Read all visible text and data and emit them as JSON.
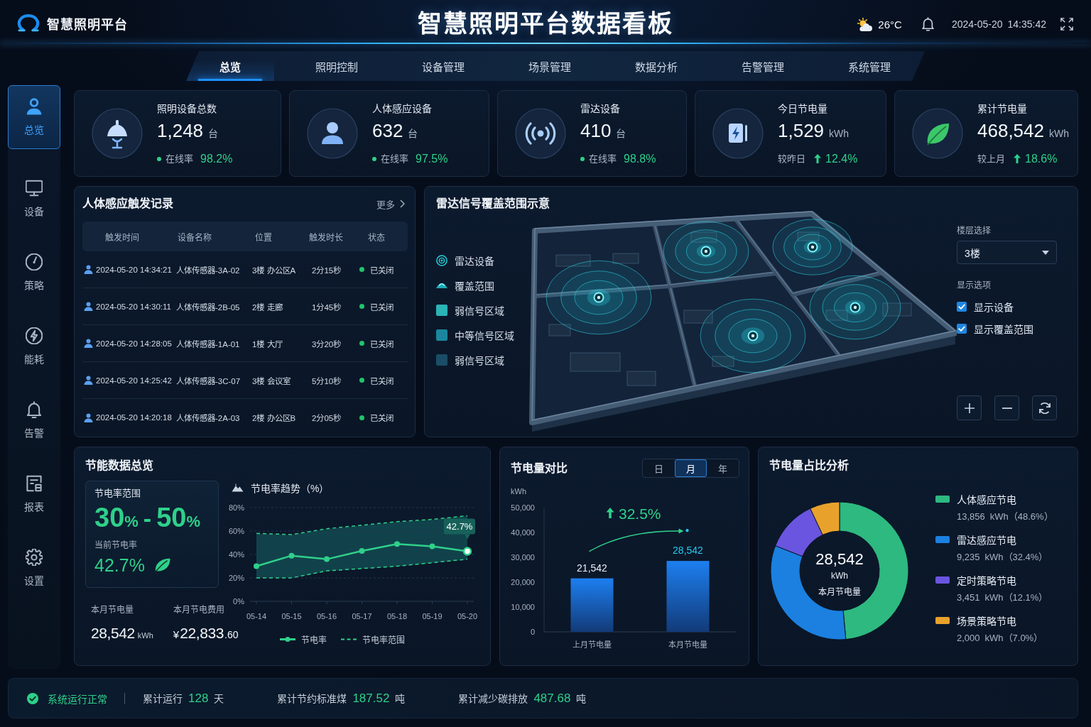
{
  "header": {
    "logo_text": "智慧照明平台",
    "title": "智慧照明平台数据看板",
    "temperature": "26°C",
    "date": "2024-05-20",
    "time": "14:35:42"
  },
  "nav_tabs": [
    {
      "label": "总览",
      "selected": true
    },
    {
      "label": "照明控制",
      "selected": false
    },
    {
      "label": "设备管理",
      "selected": false
    },
    {
      "label": "场景管理",
      "selected": false
    },
    {
      "label": "数据分析",
      "selected": false
    },
    {
      "label": "告警管理",
      "selected": false
    },
    {
      "label": "系统管理",
      "selected": false
    }
  ],
  "sidebar": {
    "items": [
      {
        "label": "总览",
        "selected": true
      },
      {
        "label": "设备",
        "selected": false
      },
      {
        "label": "策略",
        "selected": false
      },
      {
        "label": "能耗",
        "selected": false
      },
      {
        "label": "告警",
        "selected": false
      },
      {
        "label": "报表",
        "selected": false
      },
      {
        "label": "设置",
        "selected": false
      }
    ]
  },
  "kpi_cards": [
    {
      "kind": "online",
      "label": "照明设备总数",
      "value": "1,248",
      "unit": "台",
      "sub_label": "在线率",
      "sub_value": "98.2%"
    },
    {
      "kind": "online",
      "label": "人体感应设备",
      "value": "632",
      "unit": "台",
      "sub_label": "在线率",
      "sub_value": "97.5%"
    },
    {
      "kind": "online",
      "label": "雷达设备",
      "value": "410",
      "unit": "台",
      "sub_label": "在线率",
      "sub_value": "98.8%"
    },
    {
      "kind": "change",
      "label": "今日节电量",
      "value": "1,529",
      "unit": "kWh",
      "sub_label": "较昨日",
      "sub_value": "12.4%",
      "increase": true
    },
    {
      "kind": "change",
      "label": "累计节电量",
      "value": "468,542",
      "unit": "kWh",
      "sub_label": "较上月",
      "sub_value": "18.6%",
      "increase": true
    }
  ],
  "trigger_records": {
    "title": "人体感应触发记录",
    "more_link": "更多",
    "columns": [
      "触发时间",
      "设备名称",
      "位置",
      "触发时长",
      "状态"
    ],
    "rows": [
      {
        "cells": [
          "2024-05-20 14:34:21",
          "人体传感器-3A-02",
          "3楼 办公区A",
          "2分15秒",
          "已关闭"
        ]
      },
      {
        "cells": [
          "2024-05-20 14:30:11",
          "人体传感器-2B-05",
          "2楼 走廊",
          "1分45秒",
          "已关闭"
        ]
      },
      {
        "cells": [
          "2024-05-20 14:28:05",
          "人体传感器-1A-01",
          "1楼 大厅",
          "3分20秒",
          "已关闭"
        ]
      },
      {
        "cells": [
          "2024-05-20 14:25:42",
          "人体传感器-3C-07",
          "3楼 会议室",
          "5分10秒",
          "已关闭"
        ]
      },
      {
        "cells": [
          "2024-05-20 14:20:18",
          "人体传感器-2A-03",
          "2楼 办公区B",
          "2分05秒",
          "已关闭"
        ]
      }
    ]
  },
  "radar_panel": {
    "title": "雷达信号覆盖范围示意",
    "legend": [
      {
        "kind": "device",
        "label": "雷达设备"
      },
      {
        "kind": "coverage",
        "label": "覆盖范围"
      },
      {
        "kind": "swatch",
        "label": "弱信号区域",
        "color": "#2bb3b6"
      },
      {
        "kind": "swatch",
        "label": "中等信号区域",
        "color": "#1a879e"
      },
      {
        "kind": "swatch",
        "label": "弱信号区域",
        "color": "#1b4d66"
      }
    ],
    "floor_select": {
      "label": "楼层选择",
      "value": "3楼"
    },
    "display_options": {
      "label": "显示选项",
      "options": [
        {
          "label": "显示设备",
          "checked": true
        },
        {
          "label": "显示覆盖范围",
          "checked": true
        }
      ]
    }
  },
  "energy_overview": {
    "title": "节能数据总览",
    "range_card": {
      "label": "节电率范围",
      "range": [
        {
          "value": "30",
          "unit": "%"
        },
        {
          "value": "50",
          "unit": "%"
        }
      ],
      "separator": "-",
      "current_label": "当前节电率",
      "current_value": "42.7%"
    },
    "month_saving": {
      "label": "本月节电量",
      "value": "28,542",
      "unit": "kWh"
    },
    "month_cost": {
      "label": "本月节电费用",
      "currency": "¥",
      "value": "22,833",
      "decimals": ".60"
    },
    "trend": {
      "title": "节电率趋势（%）",
      "chart_data": {
        "type": "line",
        "categories": [
          "05-14",
          "05-15",
          "05-16",
          "05-17",
          "05-18",
          "05-19",
          "05-20"
        ],
        "ylim": [
          0,
          80
        ],
        "yticks": [
          {
            "value": 0,
            "label": "0%"
          },
          {
            "value": 20,
            "label": "20%"
          },
          {
            "value": 40,
            "label": "40%"
          },
          {
            "value": 60,
            "label": "60%"
          },
          {
            "value": 80,
            "label": "80%"
          }
        ],
        "grid": true,
        "series": [
          {
            "name": "节电率",
            "color": "#2fd08a",
            "marker": "circle",
            "values": [
              30,
              39,
              36,
              43,
              49,
              47,
              42.7
            ]
          },
          {
            "name": "节电率范围",
            "color": "#2fd08a",
            "line_style": "dashed",
            "values": [
              58,
              57,
              62,
              65,
              68,
              70,
              73
            ]
          },
          {
            "color": "#2fd08a",
            "line_style": "dashed",
            "values": [
              20,
              20,
              26,
              28,
              30,
              33,
              36
            ]
          }
        ],
        "annotations": [
          {
            "x": "05-20",
            "y": 42.7,
            "text": "42.7%"
          }
        ]
      }
    }
  },
  "saving_compare": {
    "title": "节电量对比",
    "periods": [
      {
        "label": "日",
        "selected": false
      },
      {
        "label": "月",
        "selected": true
      },
      {
        "label": "年",
        "selected": false
      }
    ],
    "chart_data": {
      "type": "bar",
      "ylabel": "kWh",
      "categories": [
        "上月节电量",
        "本月节电量"
      ],
      "values": [
        21542,
        28542
      ],
      "ylim": [
        0,
        50000
      ],
      "yticks": [
        {
          "value": 0,
          "label": "0"
        },
        {
          "value": 10000,
          "label": "10,000"
        },
        {
          "value": 20000,
          "label": "20,000"
        },
        {
          "value": 30000,
          "label": "30,000"
        },
        {
          "value": 40000,
          "label": "40,000"
        },
        {
          "value": 50000,
          "label": "50,000"
        }
      ],
      "value_labels": [
        "21,542",
        "28,542"
      ],
      "annotations": [
        {
          "text": "32.5%"
        }
      ]
    }
  },
  "saving_share": {
    "title": "节电量占比分析",
    "center_value": "28,542",
    "center_unit": "kWh",
    "center_label": "本月节电量",
    "chart_data": {
      "type": "donut",
      "categories": [
        "人体感应节电",
        "雷达感应节电",
        "定时策略节电",
        "场景策略节电"
      ],
      "values": [
        48.6,
        32.4,
        12.1,
        7.0
      ],
      "colors": [
        "#2db980",
        "#1b80e0",
        "#6a55e0",
        "#e8a22c"
      ],
      "value_labels": [
        "（48.6%）",
        "（32.4%）",
        "（12.1%）",
        "（7.0%）"
      ]
    },
    "legend_details": [
      {
        "amount": "13,856",
        "unit": "kWh"
      },
      {
        "amount": "9,235",
        "unit": "kWh"
      },
      {
        "amount": "3,451",
        "unit": "kWh"
      },
      {
        "amount": "2,000",
        "unit": "kWh"
      }
    ]
  },
  "status_bar": {
    "system_status": {
      "text": "系统运行正常",
      "ok": true
    },
    "stats": [
      {
        "label": "累计运行",
        "value": "128",
        "unit": "天"
      },
      {
        "label": "累计节约标准煤",
        "value": "187.52",
        "unit": "吨"
      },
      {
        "label": "累计减少碳排放",
        "value": "487.68",
        "unit": "吨"
      }
    ]
  }
}
